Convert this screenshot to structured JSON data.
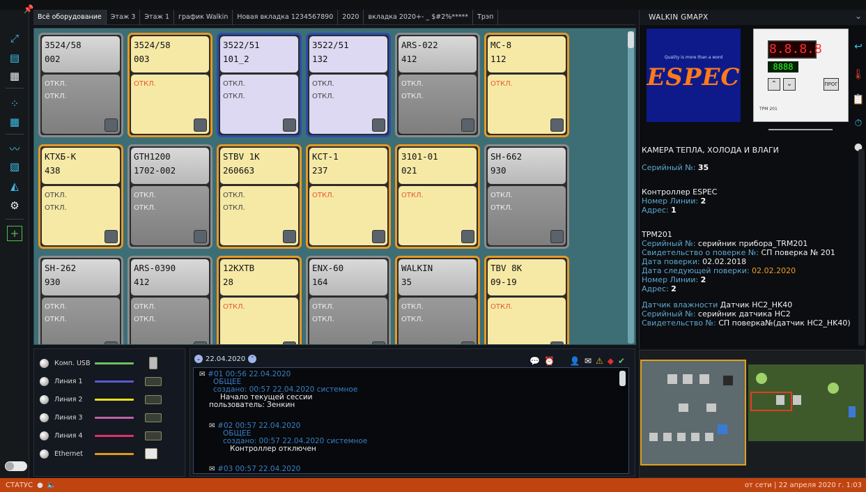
{
  "tabs": [
    "Всё оборудование",
    "Этаж 3",
    "Этаж 1",
    "график Walkin",
    "Новая вкладка 1234567890",
    "2020",
    "вкладка 2020+- _ $#2%*****",
    "Трэп"
  ],
  "cards": [
    {
      "model": "3524/58",
      "num": "002",
      "l1": "ОТКЛ.",
      "l2": "ОТКЛ.",
      "style": "gray"
    },
    {
      "model": "3524/58",
      "num": "003",
      "l1": "ОТКЛ.",
      "l2": "",
      "style": "yel",
      "red": true
    },
    {
      "model": "3522/51",
      "num": "101_2",
      "l1": "ОТКЛ.",
      "l2": "ОТКЛ.",
      "style": "blue"
    },
    {
      "model": "3522/51",
      "num": "132",
      "l1": "ОТКЛ.",
      "l2": "ОТКЛ.",
      "style": "blue"
    },
    {
      "model": "ARS-022",
      "num": "412",
      "l1": "ОТКЛ.",
      "l2": "ОТКЛ.",
      "style": "gray"
    },
    {
      "model": "MC-8",
      "num": "112",
      "l1": "ОТКЛ.",
      "l2": "",
      "style": "yel",
      "red": true
    },
    {
      "model": "КТХБ-К",
      "num": "438",
      "l1": "ОТКЛ.",
      "l2": "ОТКЛ.",
      "style": "yel"
    },
    {
      "model": "GTH1200",
      "num": "1702-002",
      "l1": "ОТКЛ.",
      "l2": "ОТКЛ.",
      "style": "gray"
    },
    {
      "model": "STBV 1K",
      "num": "260663",
      "l1": "ОТКЛ.",
      "l2": "ОТКЛ.",
      "style": "yel"
    },
    {
      "model": "КСТ-1",
      "num": "237",
      "l1": "ОТКЛ.",
      "l2": "",
      "style": "yel",
      "red": true
    },
    {
      "model": "3101-01",
      "num": "021",
      "l1": "ОТКЛ.",
      "l2": "",
      "style": "yel",
      "red": true
    },
    {
      "model": "SH-662",
      "num": "930",
      "l1": "ОТКЛ.",
      "l2": "ОТКЛ.",
      "style": "gray"
    },
    {
      "model": "SH-262",
      "num": "930",
      "l1": "ОТКЛ.",
      "l2": "ОТКЛ.",
      "style": "gray"
    },
    {
      "model": "ARS-0390",
      "num": "412",
      "l1": "ОТКЛ.",
      "l2": "ОТКЛ.",
      "style": "gray"
    },
    {
      "model": "12КХТВ",
      "num": "28",
      "l1": "ОТКЛ.",
      "l2": "",
      "style": "yel",
      "red": true
    },
    {
      "model": "ENX-60",
      "num": "164",
      "l1": "ОТКЛ.",
      "l2": "ОТКЛ.",
      "style": "gray"
    },
    {
      "model": "WALKIN",
      "num": "35",
      "l1": "ОТКЛ.",
      "l2": "ОТКЛ.",
      "style": "gray",
      "orange": true
    },
    {
      "model": "TBV 8K",
      "num": "09-19",
      "l1": "ОТКЛ.",
      "l2": "",
      "style": "yel",
      "red": true
    }
  ],
  "right_panel": {
    "title": "WALKIN GMAPX",
    "espec_tagline": "Quality is more than a word",
    "espec_logo": "ESPEC",
    "trm_display_top": "8.8.8.8",
    "trm_display_bottom": "8888",
    "trm_label": "ТРМ 201",
    "heading": "КАМЕРА ТЕПЛА, ХОЛОДА И ВЛАГИ",
    "serial_label": "Серийный №:",
    "serial_value": "35",
    "ctrl_title": "Контроллер ESPEC",
    "ctrl_line_label": "Номер Линии:",
    "ctrl_line_value": "2",
    "ctrl_addr_label": "Адрес:",
    "ctrl_addr_value": "1",
    "trm_title": "ТРМ201",
    "trm_serial_label": "Серийный №:",
    "trm_serial_value": "серийник прибора_TRM201",
    "trm_cert_label": "Свидетельство о поверке №:",
    "trm_cert_value": "СП поверка № 201",
    "trm_date_label": "Дата поверки:",
    "trm_date_value": "02.02.2018",
    "trm_next_label": "Дата следующей поверки:",
    "trm_next_value": "02.02.2020",
    "trm_line_label": "Номер Линии:",
    "trm_line_value": "2",
    "trm_addr_label": "Адрес:",
    "trm_addr_value": "2",
    "sensor_label": "Датчик влажности",
    "sensor_value": "Датчик HC2_HK40",
    "sensor_serial_label": "Серийный №:",
    "sensor_serial_value": "серийник датчика HC2",
    "sensor_cert_label": "Свидетельство №:",
    "sensor_cert_value": "СП поверка№(датчик HC2_HK40)"
  },
  "legend": [
    {
      "label": "Комп. USB",
      "color": "#6fc060",
      "device": "usb"
    },
    {
      "label": "Линия 1",
      "color": "#5a5ad6",
      "device": "port"
    },
    {
      "label": "Линия 2",
      "color": "#f0e018",
      "device": "port"
    },
    {
      "label": "Линия 3",
      "color": "#c060a8",
      "device": "port"
    },
    {
      "label": "Линия 4",
      "color": "#e0306a",
      "device": "port"
    },
    {
      "label": "Ethernet",
      "color": "#e09a18",
      "device": "eth"
    }
  ],
  "log": {
    "date": "22.04.2020",
    "entries": [
      {
        "head": "#01 00:56 22.04.2020",
        "type": "ОБЩЕЕ",
        "created": "создано: 00:57  22.04.2020 системное",
        "text1": "Начало текущей сессии",
        "text2": "пользователь: Зенкин"
      },
      {
        "head": "#02 00:57 22.04.2020",
        "type": "ОБЩЕЕ",
        "created": "создано: 00:57  22.04.2020 системное",
        "text1": "Контроллер отключен",
        "text2": ""
      },
      {
        "head": "#03 00:57 22.04.2020",
        "type": "",
        "created": "",
        "text1": "",
        "text2": ""
      }
    ]
  },
  "status": {
    "label": "СТАТУС",
    "right": "от сети  |  22 апреля 2020 г.  1:03"
  }
}
